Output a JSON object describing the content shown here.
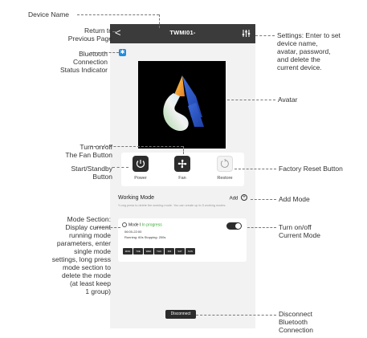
{
  "app": {
    "device_title": "TWMI01-",
    "back_glyph": "<",
    "bluetooth_glyph": "✱"
  },
  "controls": {
    "power_label": "Power",
    "fan_label": "Fan",
    "restore_label": "Restore"
  },
  "working_mode": {
    "title": "Working Mode",
    "add_label": "Add",
    "hint": "*Long press to delete the working mode. You can create up to 5 working modes.",
    "mode": {
      "name": "Mode I",
      "status": "In progress",
      "time": "06:00-22:00",
      "running": "Running:  60s  Stopping:  200s",
      "days": [
        "MON",
        "TUE",
        "WED",
        "THU",
        "FRI",
        "SAT",
        "SUN"
      ],
      "enabled": true
    }
  },
  "disconnect_label": "Disconnect",
  "annotations": {
    "device_name": "Device Name",
    "return": "Return to\nPrevious Page",
    "bluetooth": "Bluetooth\nConnection\nStatus Indicator",
    "settings": "Settings: Enter to set\ndevice name,\navatar, password,\nand delete the\ncurrent device.",
    "avatar": "Avatar",
    "fan": "Turn on/off\nThe Fan Button",
    "standby": "Start/Standby\nButton",
    "factory_reset": "Factory Reset Button",
    "add_mode": "Add Mode",
    "mode_section": "Mode Section:\nDisplay current\nrunning mode\nparameters, enter\nsingle mode\nsettings, long press\nmode section to\ndelete the mode\n(at least keep\n1 group)",
    "turn_mode": "Turn on/off\nCurrent Mode",
    "disconnect": "Disconnect\nBluetooth\nConnection"
  },
  "colors": {
    "topbar": "#3b3b3b",
    "bluetooth": "#1e8fe0",
    "in_progress": "#3aaa35",
    "dark_button": "#2c2c2c"
  }
}
